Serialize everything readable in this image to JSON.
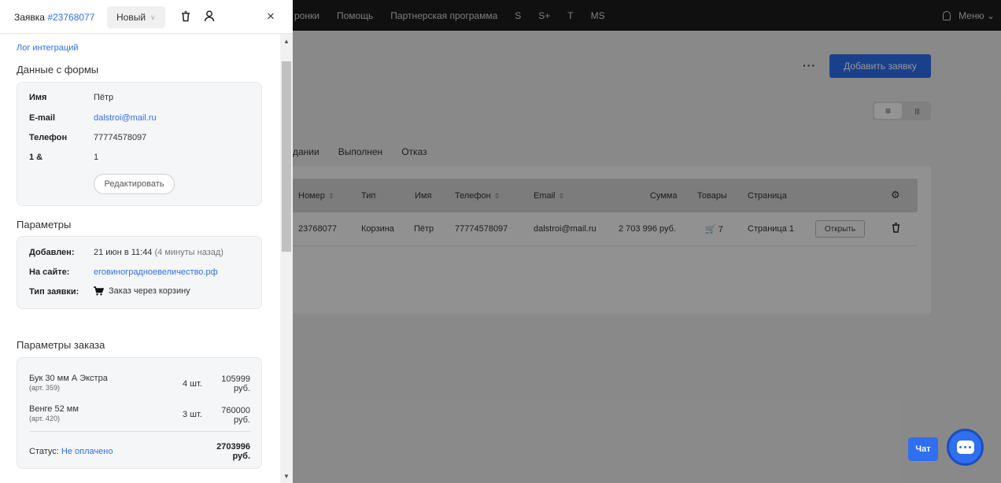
{
  "topnav": {
    "items": [
      "ронки",
      "Помощь",
      "Партнерская программа",
      "S",
      "S+",
      "T",
      "MS"
    ],
    "menu_label": "Меню"
  },
  "toolbar": {
    "more": "···",
    "add_label": "Добавить заявку"
  },
  "view_toggle": {
    "list": "≡",
    "board": "|||"
  },
  "status_tabs": [
    "дании",
    "Выполнен",
    "Отказ"
  ],
  "table": {
    "columns": [
      "Номер",
      "Тип",
      "Имя",
      "Телефон",
      "Email",
      "Сумма",
      "Товары",
      "Страница"
    ],
    "row": {
      "number": "23768077",
      "type": "Корзина",
      "name": "Пётр",
      "phone": "77774578097",
      "email": "dalstroi@mail.ru",
      "sum": "2 703 996 руб.",
      "goods": "7",
      "page": "Страница 1",
      "open_label": "Открыть"
    }
  },
  "chat": {
    "label": "Чат"
  },
  "panel": {
    "title_prefix": "Заявка ",
    "order_id": "#23768077",
    "status": "Новый",
    "log_link": "Лог интеграций",
    "form_section": {
      "title": "Данные с формы",
      "fields": [
        {
          "key": "Имя",
          "value": "Пётр"
        },
        {
          "key": "E-mail",
          "value": "dalstroi@mail.ru"
        },
        {
          "key": "Телефон",
          "value": "77774578097"
        },
        {
          "key": "1 &",
          "value": "1"
        }
      ],
      "edit_label": "Редактировать"
    },
    "params_section": {
      "title": "Параметры",
      "added_key": "Добавлен:",
      "added_value": "21 июн в 11:44",
      "added_ago": "(4 минуты назад)",
      "site_key": "На сайте:",
      "site_value": "еговиноградноевеличество.рф",
      "type_key": "Тип заявки:",
      "type_value": "Заказ через корзину"
    },
    "order_section": {
      "title": "Параметры заказа",
      "items": [
        {
          "name": "Бук 30 мм А Экстра",
          "sku": "(арт. 359)",
          "qty": "4 шт.",
          "price": "105999",
          "currency": "руб."
        },
        {
          "name": "Венге 52 мм",
          "sku": "(арт. 420)",
          "qty": "3 шт.",
          "price": "760000",
          "currency": "руб."
        }
      ],
      "status_label": "Статус:",
      "status_value": "Не оплачено",
      "total": "2703996",
      "total_currency": "руб."
    }
  }
}
